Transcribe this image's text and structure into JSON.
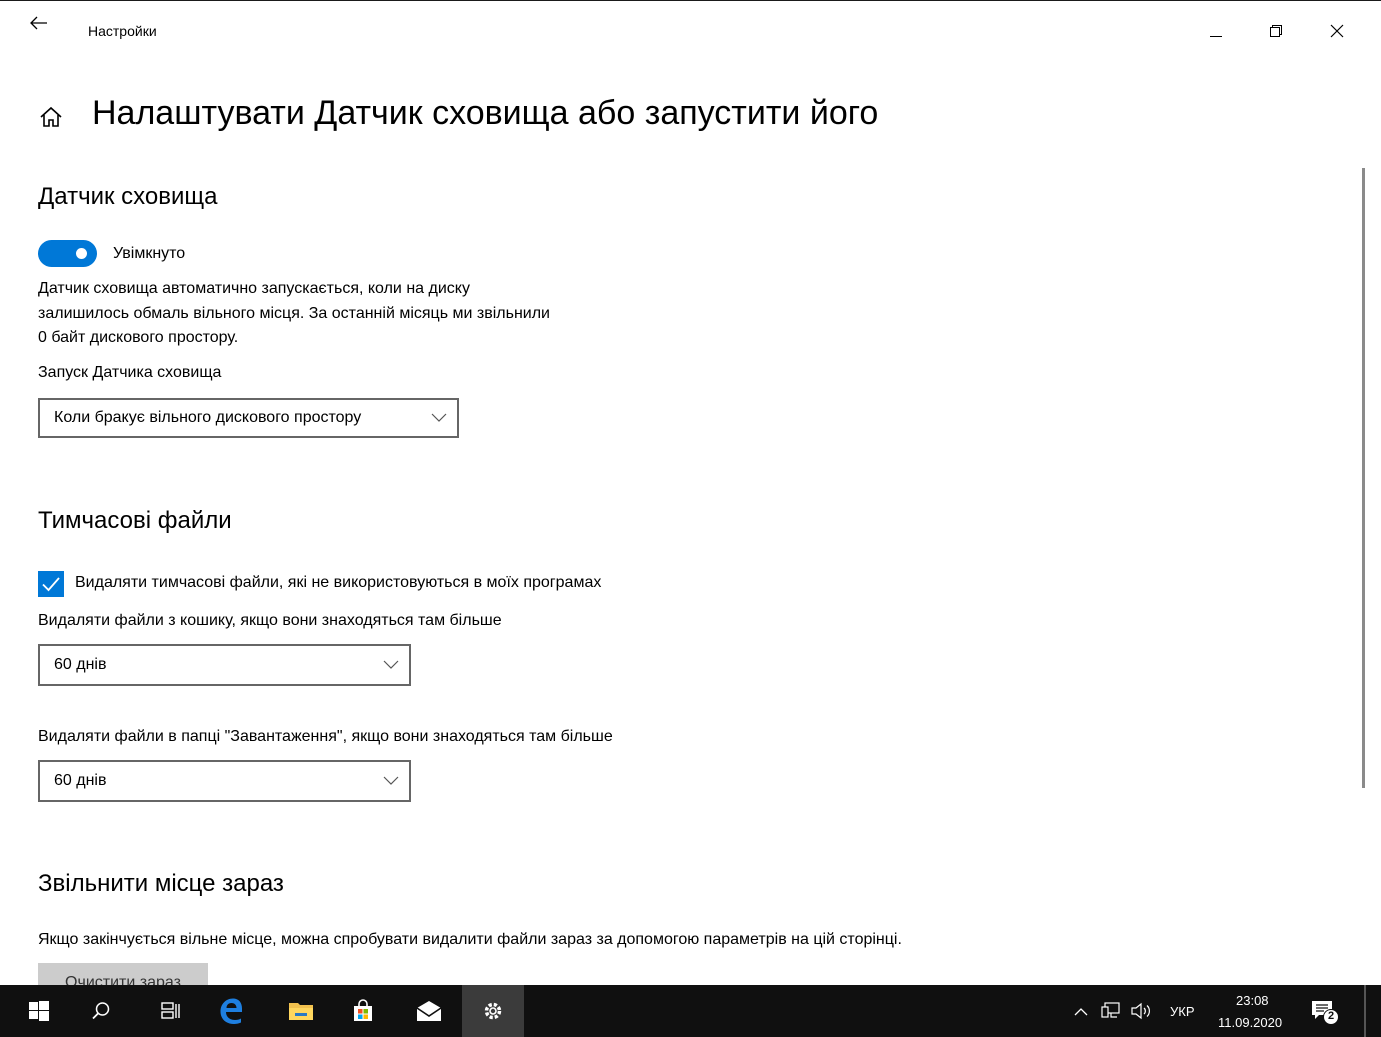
{
  "window": {
    "title": "Настройки",
    "controls": {
      "minimize": "minimize",
      "restore": "restore",
      "close": "close"
    }
  },
  "page": {
    "title": "Налаштувати Датчик сховища або запустити його"
  },
  "storage_sense": {
    "heading": "Датчик сховища",
    "toggle_label": "Увімкнуто",
    "toggle_on": true,
    "description_lines": [
      "Датчик сховища автоматично запускається, коли на диску",
      "залишилось обмаль вільного місця. За останній місяць ми звільнили",
      "0 байт дискового простору."
    ],
    "run_label": "Запуск Датчика сховища",
    "run_value": "Коли бракує вільного дискового простору"
  },
  "temp_files": {
    "heading": "Тимчасові файли",
    "checkbox_label": "Видаляти тимчасові файли, які не використовуються в моїх програмах",
    "checkbox_checked": true,
    "recycle_label": "Видаляти файли з кошику, якщо вони знаходяться там більше",
    "recycle_value": "60 днів",
    "downloads_label": "Видаляти файли в папці \"Завантаження\", якщо вони знаходяться там більше",
    "downloads_value": "60 днів"
  },
  "free_now": {
    "heading": "Звільнити місце зараз",
    "description": "Якщо закінчується вільне місце, можна спробувати видалити файли зараз за допомогою параметрів на цій сторінці.",
    "button": "Очистити зараз"
  },
  "taskbar": {
    "icons": [
      "windows-start-icon",
      "search-icon",
      "task-view-icon",
      "edge-icon",
      "file-explorer-icon",
      "store-icon",
      "mail-icon",
      "settings-icon"
    ],
    "language": "УКР",
    "time": "23:08",
    "date": "11.09.2020",
    "notification_count": "2"
  },
  "colors": {
    "accent": "#0078d7",
    "taskbar": "#101010",
    "button_gray": "#cccccc"
  }
}
